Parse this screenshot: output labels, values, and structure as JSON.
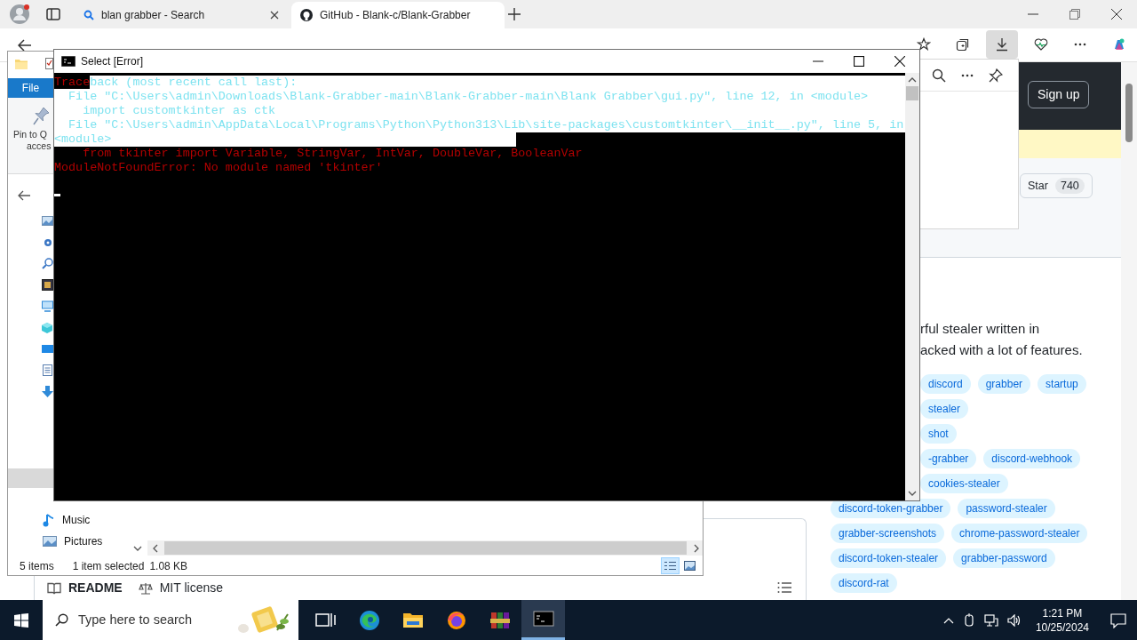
{
  "browser": {
    "tabs": [
      {
        "kind": "search",
        "title": "blan grabber - Search",
        "selected": false
      },
      {
        "kind": "github",
        "title": "GitHub - Blank-c/Blank-Grabber",
        "selected": true
      }
    ],
    "toolbar_buttons": [
      {
        "kind": "favorites",
        "selected": false
      },
      {
        "kind": "collections",
        "selected": false
      },
      {
        "kind": "downloads",
        "selected": true
      },
      {
        "kind": "health",
        "selected": false
      },
      {
        "kind": "more",
        "selected": false
      },
      {
        "kind": "copilot",
        "selected": false
      }
    ],
    "page": {
      "sign_up": "Sign up",
      "star_label": "Star",
      "star_count": "740",
      "description": [
        "rful stealer written in",
        "acked with a lot of features."
      ],
      "topics": [
        [
          "discord",
          "grabber",
          "startup"
        ],
        [
          "stealer"
        ],
        [
          "shot"
        ],
        [
          "-grabber",
          "discord-webhook"
        ],
        [
          "cookies-stealer"
        ],
        [
          "discord-token-grabber",
          "password-stealer"
        ],
        [
          "grabber-screenshots",
          "chrome-password-stealer"
        ],
        [
          "discord-token-stealer",
          "grabber-password"
        ],
        [
          "discord-rat"
        ]
      ],
      "readme_tabs": [
        {
          "kind": "book",
          "label": "README"
        },
        {
          "kind": "scale",
          "label": "MIT license"
        }
      ]
    }
  },
  "explorer": {
    "ribbon_tab": "File",
    "ribbon_button": [
      "Pin to Q",
      "acces"
    ],
    "nav_items": [
      {
        "kind": "music",
        "label": "Music"
      },
      {
        "kind": "pictures",
        "label": "Pictures"
      }
    ],
    "status": {
      "items": "5 items",
      "selected": "1 item selected",
      "size": "1.08 KB"
    },
    "view_buttons": [
      {
        "kind": "details",
        "selected": true
      },
      {
        "kind": "large-icons",
        "selected": false
      }
    ]
  },
  "console": {
    "title": "Select [Error]",
    "lines": [
      {
        "segments": [
          {
            "text": "Trace",
            "selected": false
          },
          {
            "text": "back (most recent call last):",
            "selected": true
          }
        ]
      },
      {
        "segments": [
          {
            "text": "  File \"C:\\Users\\admin\\Downloads\\Blank-Grabber-main\\Blank-Grabber-main\\Blank Grabber\\gui.py\", line 12, in <module>",
            "selected": true
          }
        ]
      },
      {
        "segments": [
          {
            "text": "    import customtkinter as ctk",
            "selected": true
          }
        ]
      },
      {
        "segments": [
          {
            "text": "  File \"C:\\Users\\admin\\AppData\\Local\\Programs\\Python\\Python313\\Lib\\site-packages\\customtkinter\\__init__.py\", line 5, in",
            "selected": true
          }
        ]
      },
      {
        "segments": [
          {
            "text": "<module>",
            "selected": true
          }
        ]
      },
      {
        "segments": [
          {
            "text": "    from tkinter import Variable, StringVar, IntVar, DoubleVar, BooleanVar",
            "selected": false
          }
        ]
      },
      {
        "segments": [
          {
            "text": "ModuleNotFoundError: No module named 'tkinter'",
            "selected": false
          }
        ]
      }
    ]
  },
  "taskbar": {
    "search_placeholder": "Type here to search",
    "apps": [
      {
        "kind": "task-view",
        "selected": false
      },
      {
        "kind": "edge",
        "selected": false
      },
      {
        "kind": "explorer",
        "selected": false
      },
      {
        "kind": "firefox",
        "selected": false
      },
      {
        "kind": "winrar",
        "selected": false
      },
      {
        "kind": "console",
        "selected": true
      }
    ],
    "time": "1:21 PM",
    "date": "10/25/2024"
  }
}
